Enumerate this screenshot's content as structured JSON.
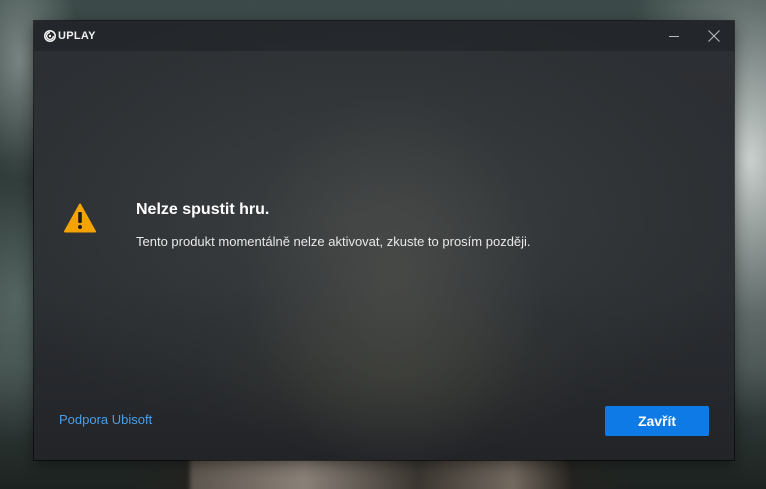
{
  "app": {
    "logo_text": "UPLAY",
    "logo_icon": "uplay-swirl-icon"
  },
  "window_controls": {
    "minimize_icon": "minimize-icon",
    "close_icon": "close-icon"
  },
  "dialog": {
    "icon": "warning-icon",
    "icon_color": "#f5a300",
    "title": "Nelze spustit hru.",
    "message": "Tento produkt momentálně nelze aktivovat, zkuste to prosím později.",
    "support_link": "Podpora Ubisoft",
    "support_link_color": "#4a9eea",
    "close_button": "Zavřít",
    "close_button_color": "#0d7ae6"
  }
}
